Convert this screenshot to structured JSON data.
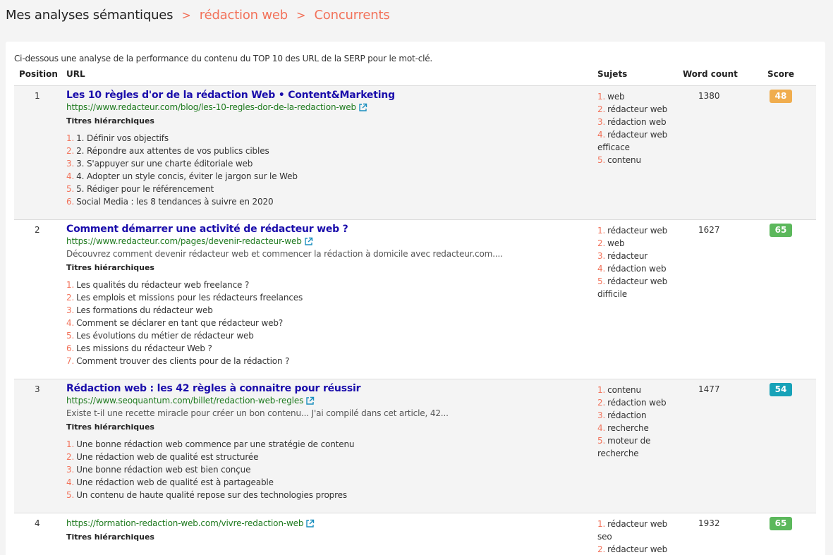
{
  "breadcrumb": {
    "root": "Mes analyses sémantiques",
    "separator": ">",
    "items": [
      "rédaction web",
      "Concurrents"
    ]
  },
  "intro": "Ci-dessous une analyse de la performance du contenu du TOP 10 des URL de la SERP pour le mot-clé.",
  "table": {
    "headers": {
      "position": "Position",
      "url": "URL",
      "sujets": "Sujets",
      "word_count": "Word count",
      "score": "Score"
    },
    "titres_label": "Titres hiérarchiques",
    "rows": [
      {
        "position": "1",
        "title": "Les 10 règles d'or de la rédaction Web • Content&Marketing",
        "url": "https://www.redacteur.com/blog/les-10-regles-dor-de-la-redaction-web",
        "description": "",
        "headings": [
          "1. Définir vos objectifs",
          "2. Répondre aux attentes de vos publics cibles",
          "3. S'appuyer sur une charte éditoriale web",
          "4. Adopter un style concis, éviter le jargon sur le Web",
          "5. Rédiger pour le référencement",
          "Social Media : les 8 tendances à suivre en 2020"
        ],
        "sujets": [
          "web",
          "rédacteur web",
          "rédaction web",
          "rédacteur web efficace",
          "contenu"
        ],
        "word_count": "1380",
        "score": "48",
        "score_color": "#f0ad4e"
      },
      {
        "position": "2",
        "title": "Comment démarrer une activité de rédacteur web ?",
        "url": "https://www.redacteur.com/pages/devenir-redacteur-web",
        "description": "Découvrez comment devenir rédacteur web et commencer la rédaction à domicile avec redacteur.com....",
        "headings": [
          "Les qualités du rédacteur web freelance ?",
          "Les emplois et missions pour les rédacteurs freelances",
          "Les formations du rédacteur web",
          "Comment se déclarer en tant que rédacteur web?",
          "Les évolutions du métier de rédacteur web",
          "Les missions du rédacteur Web ?",
          "Comment trouver des clients pour de la rédaction ?"
        ],
        "sujets": [
          "rédacteur web",
          "web",
          "rédacteur",
          "rédaction web",
          "rédacteur web difficile"
        ],
        "word_count": "1627",
        "score": "65",
        "score_color": "#5cb85c"
      },
      {
        "position": "3",
        "title": "Rédaction web : les 42 règles à connaitre pour réussir",
        "url": "https://www.seoquantum.com/billet/redaction-web-regles",
        "description": "Existe t-il une recette miracle pour créer un bon contenu... J'ai compilé dans cet article, 42...",
        "headings": [
          "Une bonne rédaction web commence par une stratégie de contenu",
          "Une rédaction web de qualité est structurée",
          "Une bonne rédaction web est bien conçue",
          "Une rédaction web de qualité est à partageable",
          "Un contenu de haute qualité repose sur des technologies propres"
        ],
        "sujets": [
          "contenu",
          "rédaction web",
          "rédaction",
          "recherche",
          "moteur de recherche"
        ],
        "word_count": "1477",
        "score": "54",
        "score_color": "#17a2b8"
      },
      {
        "position": "4",
        "title": "",
        "url": "https://formation-redaction-web.com/vivre-redaction-web",
        "description": "",
        "headings": [],
        "sujets": [
          "rédacteur web seo",
          "rédacteur web"
        ],
        "word_count": "1932",
        "score": "65",
        "score_color": "#5cb85c"
      }
    ]
  }
}
